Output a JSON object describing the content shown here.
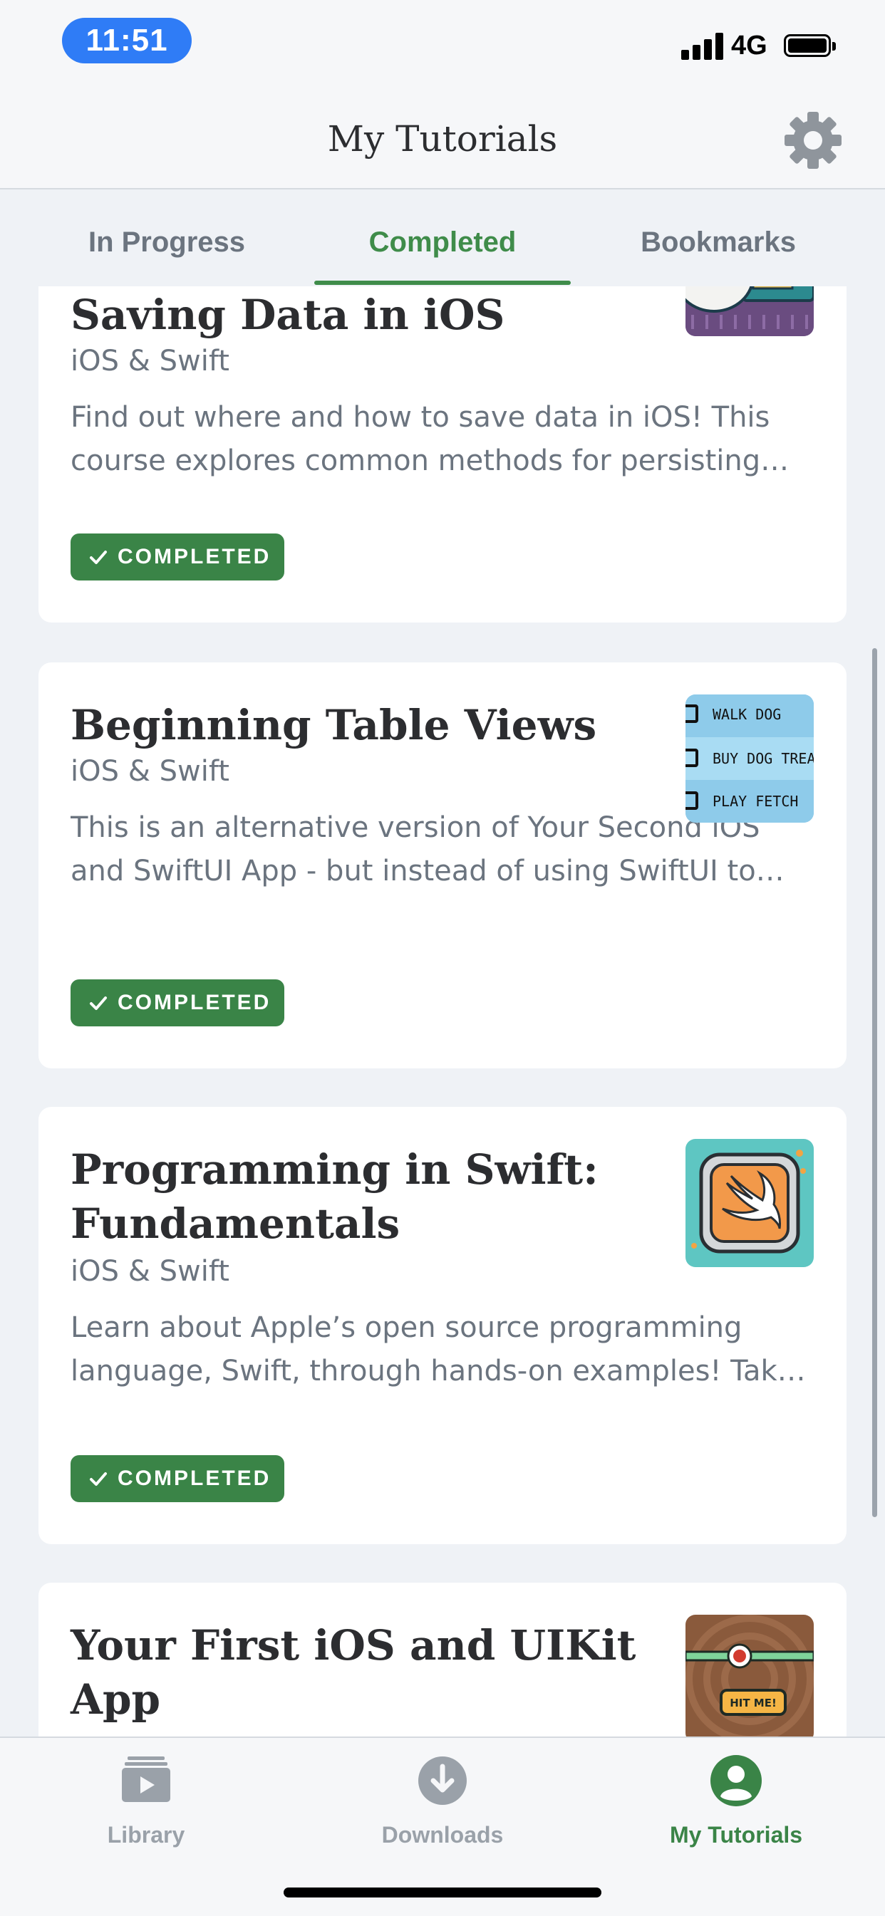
{
  "status_bar": {
    "time": "11:51",
    "network": "4G"
  },
  "nav": {
    "title": "My Tutorials"
  },
  "tabs": [
    {
      "label": "In Progress",
      "active": false
    },
    {
      "label": "Completed",
      "active": true
    },
    {
      "label": "Bookmarks",
      "active": false
    }
  ],
  "cards": [
    {
      "title": "Saving Data in iOS",
      "subtitle": "iOS & Swift",
      "description": [
        "Find out where and how to save data in iOS! This",
        "course explores common methods for persisting…"
      ],
      "badge": "COMPLETED",
      "thumbnail": "seal-with-briefcase-art"
    },
    {
      "title": "Beginning Table Views",
      "subtitle": "iOS & Swift",
      "description": [
        "This is an alternative version of Your Second iOS",
        "and SwiftUI App - but instead of using SwiftUI to…"
      ],
      "badge": "COMPLETED",
      "thumbnail": "todo-checklist-art",
      "thumb_items": [
        "WALK DOG",
        "BUY DOG TREAT",
        "PLAY FETCH"
      ]
    },
    {
      "title": "Programming in Swift: Fundamentals",
      "title_lines": [
        "Programming in Swift:",
        "Fundamentals"
      ],
      "subtitle": "iOS & Swift",
      "description": [
        "Learn about Apple’s open source programming",
        "language, Swift, through hands-on examples! Tak…"
      ],
      "badge": "COMPLETED",
      "thumbnail": "swift-logo-art"
    },
    {
      "title": "Your First iOS and UIKit App",
      "title_lines": [
        "Your First iOS and UIKit",
        "App"
      ],
      "thumbnail": "bullseye-game-art",
      "thumb_button": "HIT ME!"
    }
  ],
  "tab_bar": [
    {
      "label": "Library",
      "icon": "library-icon",
      "active": false
    },
    {
      "label": "Downloads",
      "icon": "download-icon",
      "active": false
    },
    {
      "label": "My Tutorials",
      "icon": "profile-icon",
      "active": true
    }
  ],
  "colors": {
    "accent": "#3a8447",
    "badge_bg": "#3a8447",
    "time_pill": "#2f7cf6",
    "background": "#eff2f6"
  }
}
